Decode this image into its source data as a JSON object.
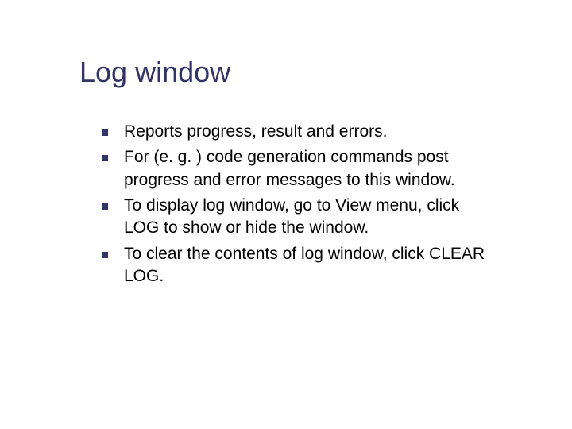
{
  "slide": {
    "title": "Log window",
    "bullets": [
      "Reports progress, result and errors.",
      "For (e. g. ) code generation commands post progress and error messages to this window.",
      "To display log window, go to View menu, click LOG to show or hide the window.",
      "To clear the contents of log window, click CLEAR LOG."
    ]
  }
}
